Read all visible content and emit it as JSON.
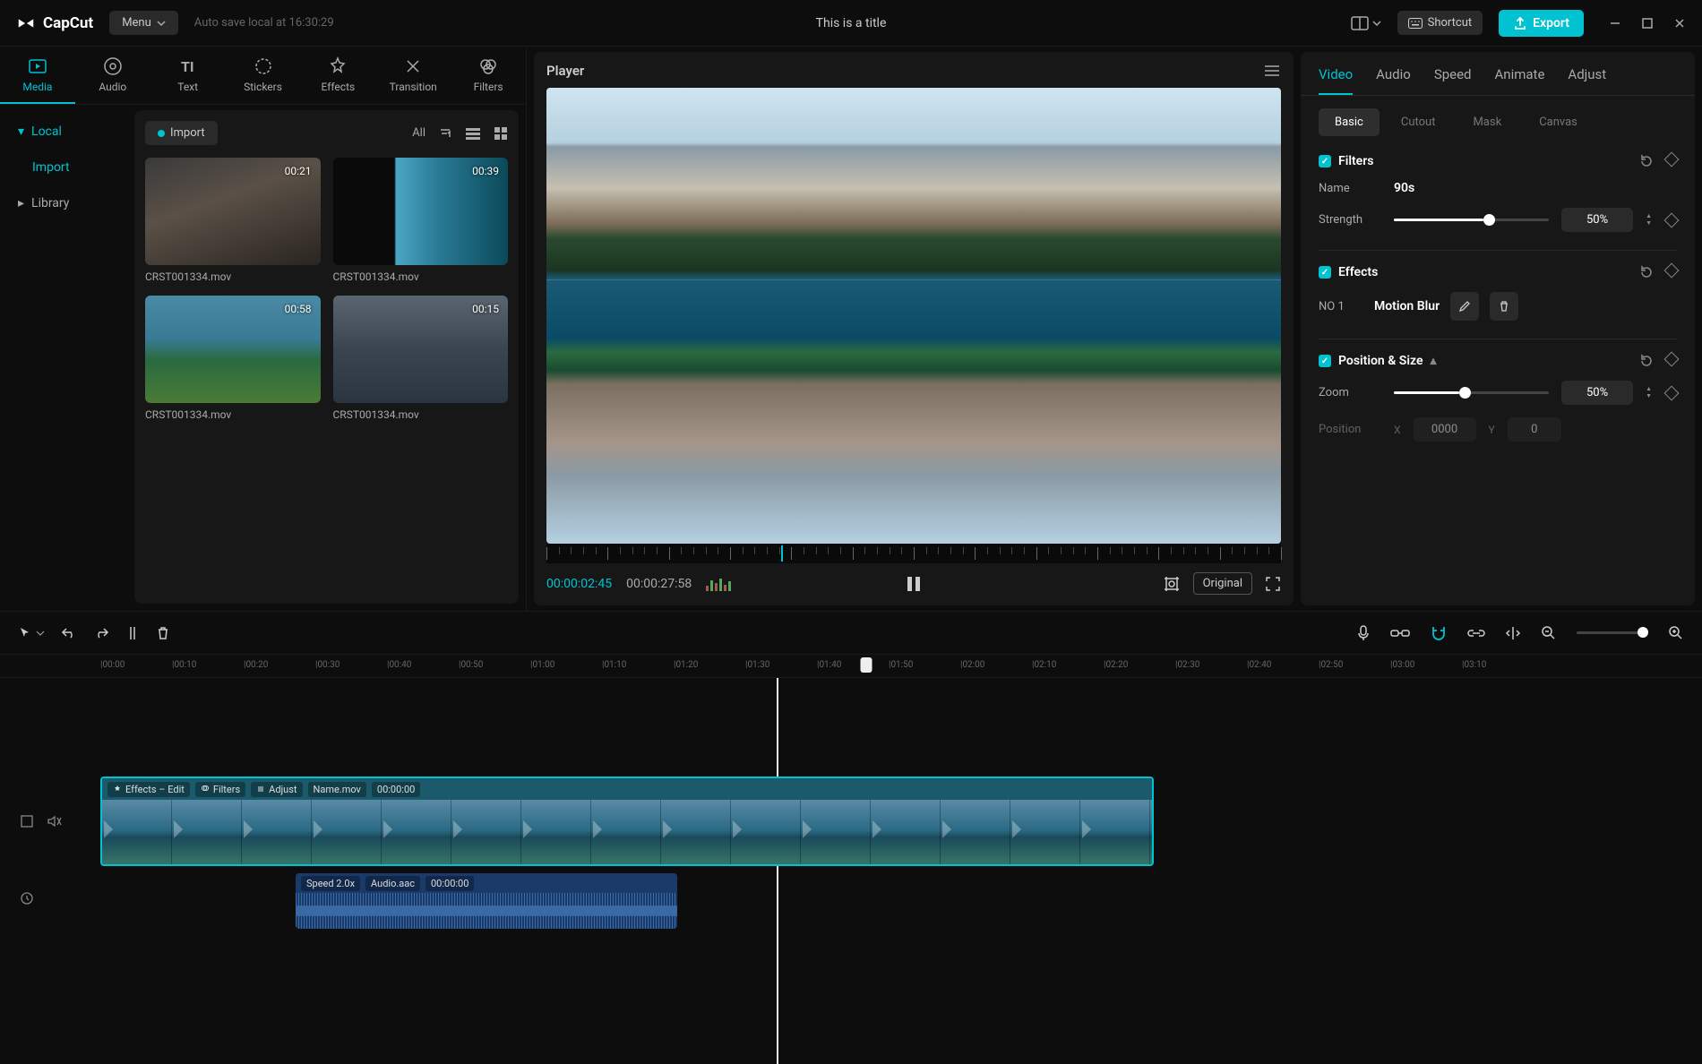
{
  "topbar": {
    "logo": "CapCut",
    "menu": "Menu",
    "autosave": "Auto save local at 16:30:29",
    "title": "This is a title",
    "shortcut": "Shortcut",
    "export": "Export"
  },
  "leftTabs": [
    {
      "label": "Media",
      "active": true
    },
    {
      "label": "Audio",
      "active": false
    },
    {
      "label": "Text",
      "active": false
    },
    {
      "label": "Stickers",
      "active": false
    },
    {
      "label": "Effects",
      "active": false
    },
    {
      "label": "Transition",
      "active": false
    },
    {
      "label": "Filters",
      "active": false
    }
  ],
  "leftSidebar": {
    "local": "Local",
    "import": "Import",
    "library": "Library"
  },
  "mediaTop": {
    "import": "Import",
    "all": "All"
  },
  "media": [
    {
      "name": "CRST001334.mov",
      "dur": "00:21"
    },
    {
      "name": "CRST001334.mov",
      "dur": "00:39"
    },
    {
      "name": "CRST001334.mov",
      "dur": "00:58"
    },
    {
      "name": "CRST001334.mov",
      "dur": "00:15"
    }
  ],
  "player": {
    "title": "Player",
    "cur": "00:00:02:45",
    "tot": "00:00:27:58",
    "original": "Original"
  },
  "right": {
    "tabs": [
      {
        "label": "Video",
        "active": true
      },
      {
        "label": "Audio"
      },
      {
        "label": "Speed"
      },
      {
        "label": "Animate"
      },
      {
        "label": "Adjust"
      }
    ],
    "subtabs": [
      {
        "label": "Basic",
        "active": true
      },
      {
        "label": "Cutout"
      },
      {
        "label": "Mask"
      },
      {
        "label": "Canvas"
      }
    ],
    "filters": {
      "title": "Filters",
      "nameLabel": "Name",
      "nameVal": "90s",
      "strengthLabel": "Strength",
      "strengthVal": "50%",
      "strengthPct": 58
    },
    "effects": {
      "title": "Effects",
      "no": "NO 1",
      "name": "Motion Blur"
    },
    "pos": {
      "title": "Position & Size",
      "zoomLabel": "Zoom",
      "zoomVal": "50%",
      "zoomPct": 42,
      "posLabel": "Position",
      "x": "0000",
      "y": "0"
    }
  },
  "timeline": {
    "labels": [
      "00:00",
      "00:10",
      "00:20",
      "00:30",
      "00:40",
      "00:50",
      "01:00",
      "01:10",
      "01:20",
      "01:30",
      "01:40",
      "01:50",
      "02:00",
      "02:10",
      "02:20",
      "02:30",
      "02:40",
      "02:50",
      "03:00",
      "03:10"
    ],
    "playheadLeft": 967,
    "videoClip": {
      "tags": [
        "Effects – Edit",
        "Filters",
        "Adjust"
      ],
      "name": "Name.mov",
      "time": "00:00:00"
    },
    "audioClip": {
      "speed": "Speed 2.0x",
      "name": "Audio.aac",
      "time": "00:00:00"
    }
  }
}
